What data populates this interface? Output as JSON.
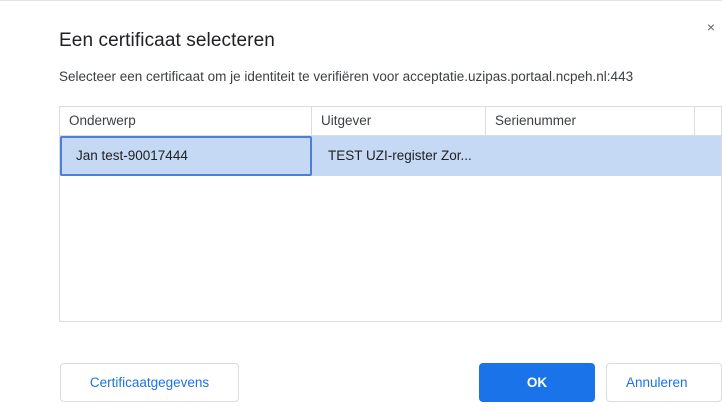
{
  "dialog": {
    "title": "Een certificaat selecteren",
    "subtitle": "Selecteer een certificaat om je identiteit te verifiëren voor acceptatie.uzipas.portaal.ncpeh.nl:443",
    "close_icon": "close-icon",
    "close_glyph": "×"
  },
  "table": {
    "columns": [
      "Onderwerp",
      "Uitgever",
      "Serienummer"
    ],
    "rows": [
      {
        "subject": "Jan test-90017444",
        "issuer": "TEST UZI-register Zor...",
        "serial": "",
        "selected": true
      }
    ],
    "selected_row_color": "#c5d9f5"
  },
  "buttons": {
    "details": "Certificaatgegevens",
    "ok": "OK",
    "cancel": "Annuleren"
  },
  "colors": {
    "accent": "#1a73e8",
    "selection_border": "#4d7fd6"
  }
}
